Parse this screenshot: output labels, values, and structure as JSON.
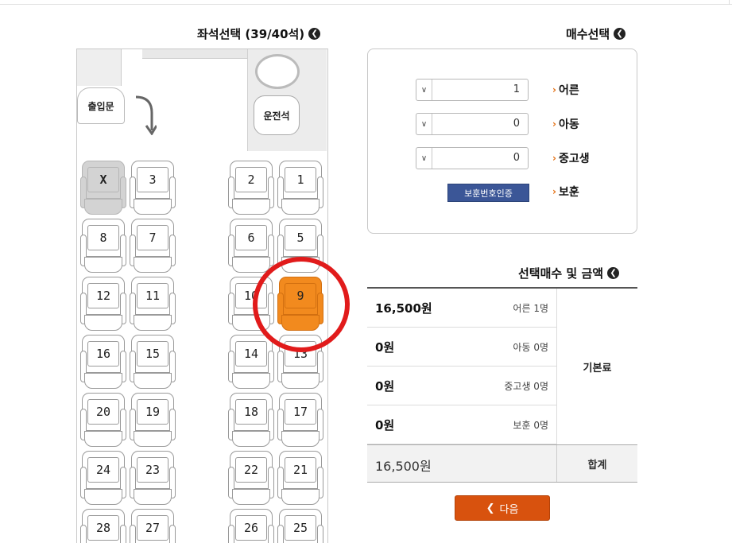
{
  "headers": {
    "seat_select": "좌석선택 (39/40석)",
    "passenger_count": "매수선택",
    "summary": "선택매수 및 금액"
  },
  "bus": {
    "driver_label": "운전석",
    "exit_label": "출입문"
  },
  "seats": [
    {
      "label": "1",
      "state": "available"
    },
    {
      "label": "2",
      "state": "available"
    },
    {
      "label": "3",
      "state": "available"
    },
    {
      "label": "X",
      "state": "taken"
    },
    {
      "label": "5",
      "state": "available"
    },
    {
      "label": "6",
      "state": "available"
    },
    {
      "label": "7",
      "state": "available"
    },
    {
      "label": "8",
      "state": "available"
    },
    {
      "label": "9",
      "state": "selected"
    },
    {
      "label": "10",
      "state": "available"
    },
    {
      "label": "11",
      "state": "available"
    },
    {
      "label": "12",
      "state": "available"
    },
    {
      "label": "13",
      "state": "available"
    },
    {
      "label": "14",
      "state": "available"
    },
    {
      "label": "15",
      "state": "available"
    },
    {
      "label": "16",
      "state": "available"
    },
    {
      "label": "17",
      "state": "available"
    },
    {
      "label": "18",
      "state": "available"
    },
    {
      "label": "19",
      "state": "available"
    },
    {
      "label": "20",
      "state": "available"
    },
    {
      "label": "21",
      "state": "available"
    },
    {
      "label": "22",
      "state": "available"
    },
    {
      "label": "23",
      "state": "available"
    },
    {
      "label": "24",
      "state": "available"
    },
    {
      "label": "25",
      "state": "available"
    },
    {
      "label": "26",
      "state": "available"
    },
    {
      "label": "27",
      "state": "available"
    },
    {
      "label": "28",
      "state": "available"
    }
  ],
  "passengers": [
    {
      "label": "어른",
      "value": "1"
    },
    {
      "label": "아동",
      "value": "0"
    },
    {
      "label": "중고생",
      "value": "0"
    },
    {
      "label": "보훈",
      "button": "보훈번호인증"
    }
  ],
  "summary_rows": [
    {
      "desc": "어른 1명",
      "amount": "16,500원"
    },
    {
      "desc": "아동 0명",
      "amount": "0원"
    },
    {
      "desc": "중고생 0명",
      "amount": "0원"
    },
    {
      "desc": "보훈 0명",
      "amount": "0원"
    }
  ],
  "summary_group_label": "기본료",
  "total": {
    "label": "합계",
    "amount": "16,500원"
  },
  "next_button": "다음",
  "colors": {
    "selected_seat": "#f28a1e",
    "taken_seat": "#d3d3d3",
    "highlight_ring": "#e11b1b",
    "next_button": "#d8520e",
    "verify_button": "#3b5697",
    "label_marker": "#e36b0b"
  },
  "icons": {
    "section_header": "circle-chevron-icon",
    "select_dropdown": "chevron-down-icon",
    "label_marker": "chevron-right-icon",
    "exit_direction": "curved-arrow-down-icon",
    "steering_wheel": "steering-wheel-icon"
  }
}
